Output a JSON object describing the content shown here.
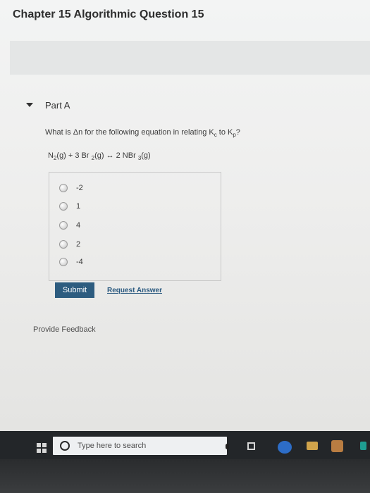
{
  "header": {
    "title": "Chapter 15 Algorithmic Question 15"
  },
  "part": {
    "label": "Part A"
  },
  "question": {
    "text": "What is Δn for the following equation in relating K",
    "sub1": "c",
    "middle": " to K",
    "sub2": "p",
    "end": "?"
  },
  "equation": {
    "n2": "N",
    "n2sub": "2",
    "g1": "(g) + 3 Br ",
    "br2sub": "2",
    "g2": "(g) ↔ 2 NBr ",
    "nbr3sub": "3",
    "g3": "(g)"
  },
  "choices": [
    {
      "label": "-2"
    },
    {
      "label": "1"
    },
    {
      "label": "4"
    },
    {
      "label": "2"
    },
    {
      "label": "-4"
    }
  ],
  "buttons": {
    "submit": "Submit",
    "request": "Request Answer"
  },
  "feedback": {
    "label": "Provide Feedback"
  },
  "taskbar": {
    "search_placeholder": "Type here to search"
  },
  "icons": {
    "caret": "caret-down-icon",
    "windows": "windows-icon",
    "search": "search-icon",
    "microphone": "microphone-icon",
    "task_view": "task-view-icon",
    "edge": "edge-icon",
    "file_explorer": "file-explorer-icon",
    "store": "store-icon",
    "app": "app-icon"
  }
}
